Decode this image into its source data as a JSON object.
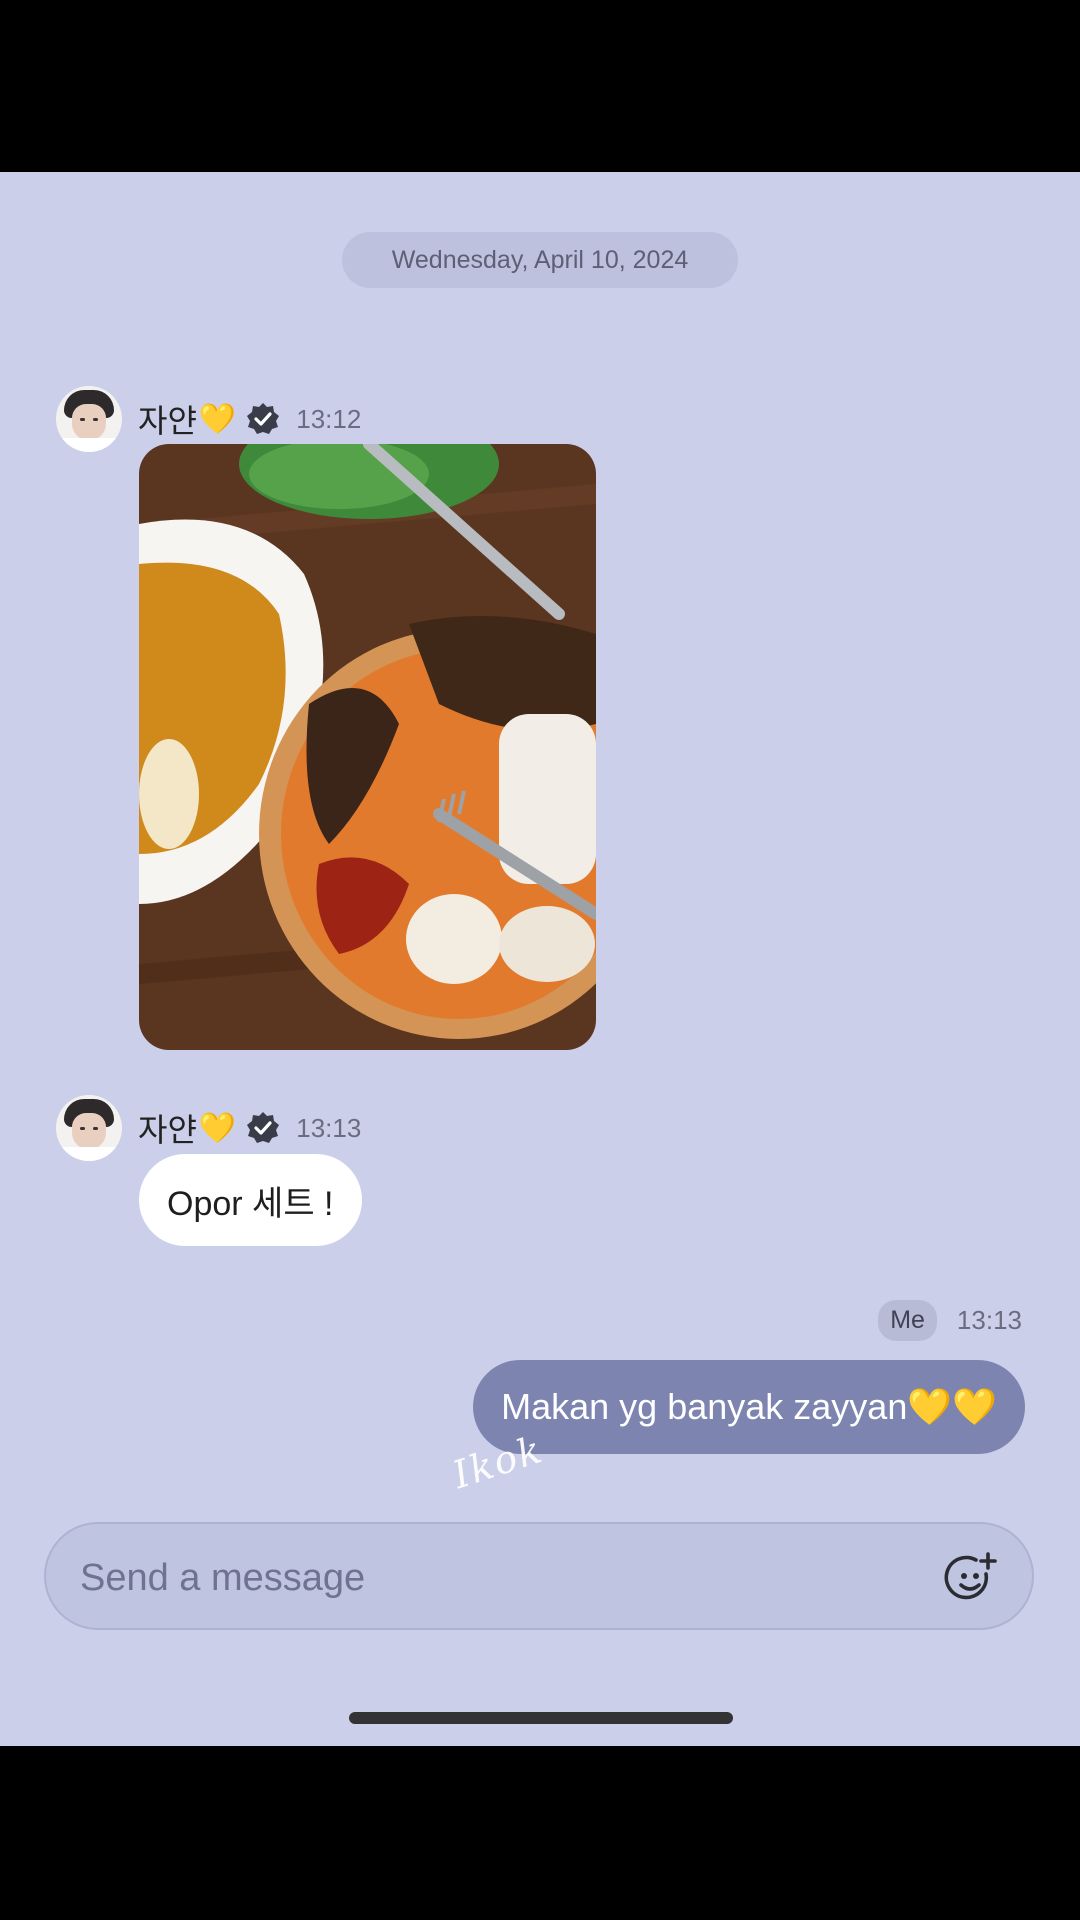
{
  "chat": {
    "date_separator": "Wednesday, April 10, 2024",
    "messages": [
      {
        "sender": "자얀",
        "heart": "💛",
        "time": "13:12",
        "type": "image"
      },
      {
        "sender": "자얀",
        "heart": "💛",
        "time": "13:13",
        "type": "text",
        "text": "Opor 세트 !"
      },
      {
        "sender": "Me",
        "time": "13:13",
        "type": "text",
        "text": "Makan yg banyak zayyan💛💛"
      }
    ]
  },
  "composer": {
    "placeholder": "Send a message",
    "emoji_icon": "emoji-add-icon"
  },
  "watermark": "Ikok",
  "colors": {
    "background": "#cbcfea",
    "outgoing_bubble": "#7d84b0",
    "incoming_bubble": "#ffffff",
    "heart": "#f4c430"
  }
}
